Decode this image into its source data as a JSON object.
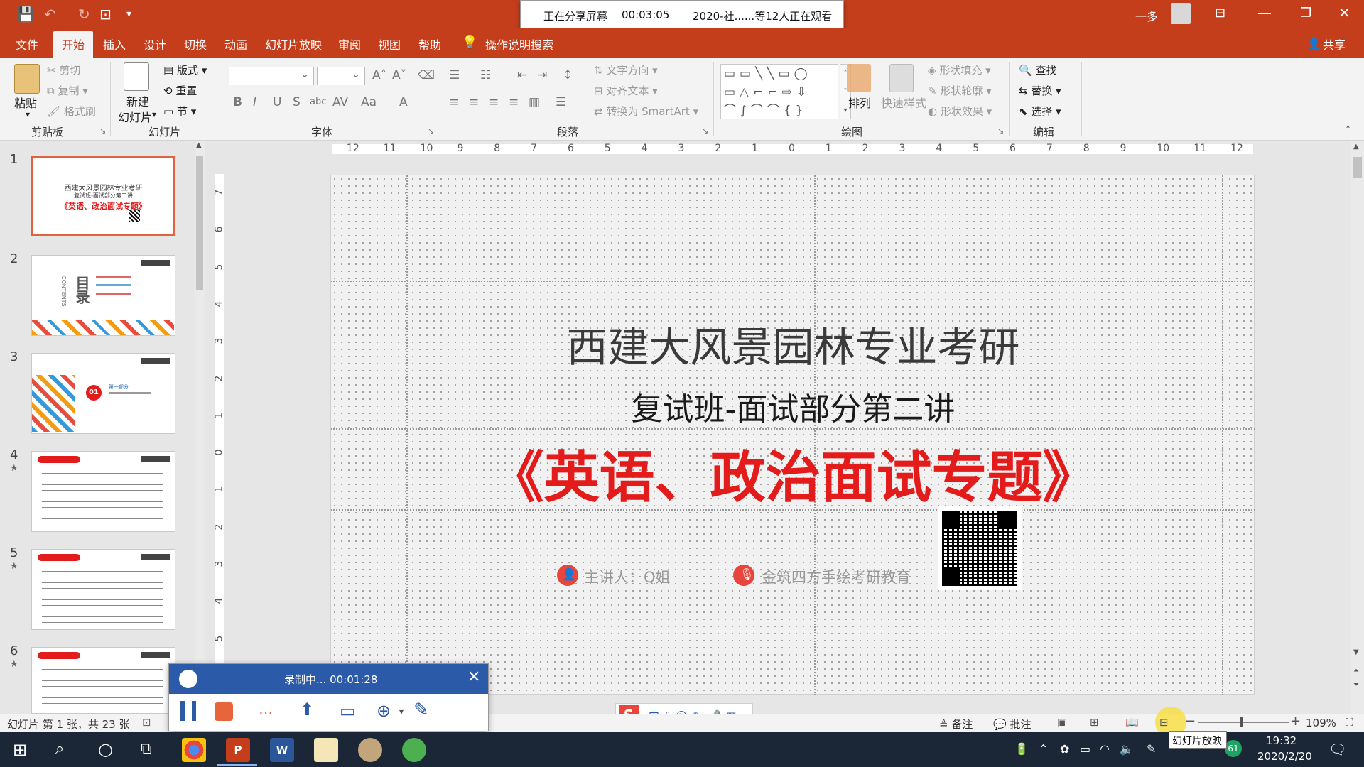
{
  "titlebar": {
    "account": "一多",
    "window_controls": [
      "minimize-icon",
      "restore-icon",
      "close-icon"
    ]
  },
  "share_banner": {
    "status": "正在分享屏幕",
    "time": "00:03:05",
    "viewers": "2020-社......等12人正在观看"
  },
  "menu": {
    "tabs": [
      "文件",
      "开始",
      "插入",
      "设计",
      "切换",
      "动画",
      "幻灯片放映",
      "审阅",
      "视图",
      "帮助"
    ],
    "active": "开始",
    "search": "操作说明搜索",
    "share": "共享"
  },
  "ribbon": {
    "clipboard": {
      "paste": "粘贴",
      "cut": "剪切",
      "copy": "复制",
      "format_painter": "格式刷",
      "label": "剪贴板"
    },
    "slides": {
      "new_slide": "新建",
      "new_slide2": "幻灯片",
      "layout": "版式",
      "reset": "重置",
      "section": "节",
      "label": "幻灯片"
    },
    "font": {
      "label": "字体",
      "buttons": [
        "B",
        "I",
        "U",
        "S",
        "abc",
        "AV",
        "Aa",
        "A"
      ]
    },
    "paragraph": {
      "text_direction": "文字方向",
      "align_text": "对齐文本",
      "convert_smartart": "转换为 SmartArt",
      "label": "段落"
    },
    "drawing": {
      "arrange": "排列",
      "quick_styles": "快速样式",
      "shape_fill": "形状填充",
      "shape_outline": "形状轮廓",
      "shape_effects": "形状效果",
      "label": "绘图"
    },
    "editing": {
      "find": "查找",
      "replace": "替换",
      "select": "选择",
      "label": "编辑"
    }
  },
  "thumbnails": [
    {
      "num": "1",
      "star": "",
      "lines": [
        "西建大风景园林专业考研",
        "复试班-面试部分第二讲",
        "《英语、政治面试专题》"
      ]
    },
    {
      "num": "2",
      "star": "",
      "lines": [
        "目录",
        "CONTENTS"
      ]
    },
    {
      "num": "3",
      "star": "",
      "lines": [
        "01",
        "第一部分"
      ]
    },
    {
      "num": "4",
      "star": "★",
      "lines": []
    },
    {
      "num": "5",
      "star": "★",
      "lines": []
    },
    {
      "num": "6",
      "star": "★",
      "lines": []
    }
  ],
  "ruler": {
    "h_ticks": [
      "12",
      "11",
      "10",
      "9",
      "8",
      "7",
      "6",
      "5",
      "4",
      "3",
      "2",
      "1",
      "0",
      "1",
      "2",
      "3",
      "4",
      "5",
      "6",
      "7",
      "8",
      "9",
      "10",
      "11",
      "12"
    ],
    "v_ticks": [
      "7",
      "6",
      "5",
      "4",
      "3",
      "2",
      "1",
      "0",
      "1",
      "2",
      "3",
      "4",
      "5",
      "6"
    ]
  },
  "slide": {
    "title": "西建大风景园林专业考研",
    "subtitle": "复试班-面试部分第二讲",
    "topic": "《英语、政治面试专题》",
    "presenter": "主讲人：Q姐",
    "org": "金筑四方手绘考研教育",
    "accent": "#e31b1b"
  },
  "recorder": {
    "status": "录制中... 00:01:28"
  },
  "statusbar": {
    "slide_info": "幻灯片 第 1 张，共 23 张",
    "notes": "备注",
    "comments": "批注",
    "zoom": "109%"
  },
  "tooltip": "幻灯片放映",
  "taskbar": {
    "time": "19:32",
    "date": "2020/2/20",
    "badge": "61"
  }
}
